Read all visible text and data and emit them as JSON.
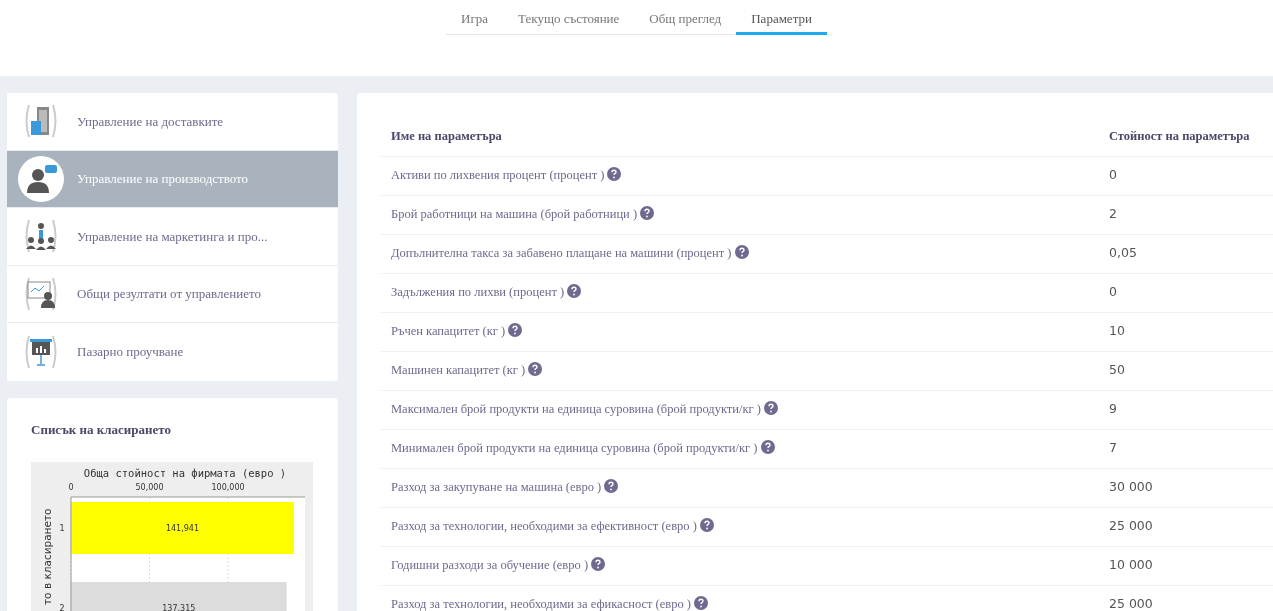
{
  "tabs": [
    {
      "label": "Игра",
      "selected": false
    },
    {
      "label": "Текущо състояние",
      "selected": false
    },
    {
      "label": "Общ преглед",
      "selected": false
    },
    {
      "label": "Параметри",
      "selected": true
    }
  ],
  "sidebar": {
    "items": [
      {
        "label": "Управление на доставките",
        "kind": "building",
        "selected": false
      },
      {
        "label": "Управление на производството",
        "kind": "presenter",
        "selected": true
      },
      {
        "label": "Управление на маркетинга и про...",
        "kind": "audience",
        "selected": false
      },
      {
        "label": "Общи резултати от управлението",
        "kind": "screen",
        "selected": false
      },
      {
        "label": "Пазарно проучване",
        "kind": "board",
        "selected": false
      }
    ]
  },
  "ranking": {
    "title": "Списък на класирането",
    "chart_data": {
      "type": "bar",
      "orientation": "horizontal",
      "title": "Обща стойност на фирмата (евро )",
      "ylabel": "то в класирането",
      "categories": [
        "1",
        "2"
      ],
      "series": [
        {
          "color": "#ffff00",
          "values": [
            141941,
            null
          ]
        },
        {
          "color": "#dcdcdc",
          "values": [
            null,
            137315
          ]
        }
      ],
      "value_labels": [
        "141,941",
        "137,315"
      ],
      "xlim": [
        0,
        149000
      ],
      "xticks": [
        {
          "value": 0,
          "label": "0"
        },
        {
          "value": 50000,
          "label": "50,000"
        },
        {
          "value": 100000,
          "label": "100,000"
        }
      ]
    }
  },
  "table": {
    "columns": [
      "Име на параметъра",
      "Стойност на параметъра"
    ],
    "rows": [
      [
        "Активи по лихвения процент (процент )",
        "0"
      ],
      [
        "Брой работници на машина (брой работници )",
        "2"
      ],
      [
        "Допълнителна такса за забавено плащане на машини (процент )",
        "0,05"
      ],
      [
        "Задължения по лихви (процент )",
        "0"
      ],
      [
        "Ръчен капацитет (кг )",
        "10"
      ],
      [
        "Машинен капацитет (кг )",
        "50"
      ],
      [
        "Максимален брой продукти на единица суровина (брой продукти/кг )",
        "9"
      ],
      [
        "Минимален брой продукти на единица суровина (брой продукти/кг )",
        "7"
      ],
      [
        "Разход за закупуване на машина (евро )",
        "30 000"
      ],
      [
        "Разход за технологии, необходими за ефективност (евро )",
        "25 000"
      ],
      [
        "Годишни разходи за обучение (евро )",
        "10 000"
      ],
      [
        "Разход за технологии, необходими за ефикасност (евро )",
        "25 000"
      ]
    ]
  }
}
